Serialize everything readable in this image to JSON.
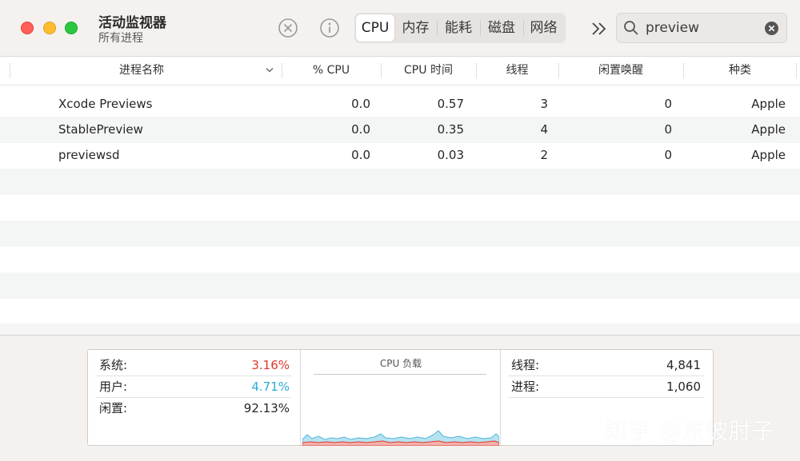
{
  "window": {
    "title": "活动监视器",
    "subtitle": "所有进程"
  },
  "toolbar": {
    "tabs": [
      {
        "label": "CPU",
        "active": true
      },
      {
        "label": "内存",
        "active": false
      },
      {
        "label": "能耗",
        "active": false
      },
      {
        "label": "磁盘",
        "active": false
      },
      {
        "label": "网络",
        "active": false
      }
    ],
    "search_value": "preview"
  },
  "table": {
    "headers": [
      "进程名称",
      "% CPU",
      "CPU 时间",
      "线程",
      "闲置唤醒",
      "种类"
    ],
    "rows": [
      {
        "name": "Xcode Previews",
        "cpu": "0.0",
        "time": "0.57",
        "threads": "3",
        "wakeups": "0",
        "kind": "Apple"
      },
      {
        "name": "StablePreview",
        "cpu": "0.0",
        "time": "0.35",
        "threads": "4",
        "wakeups": "0",
        "kind": "Apple"
      },
      {
        "name": "previewsd",
        "cpu": "0.0",
        "time": "0.03",
        "threads": "2",
        "wakeups": "0",
        "kind": "Apple"
      }
    ]
  },
  "summary": {
    "system_label": "系统:",
    "system_value": "3.16%",
    "user_label": "用户:",
    "user_value": "4.71%",
    "idle_label": "闲置:",
    "idle_value": "92.13%",
    "graph_title": "CPU 负载",
    "threads_label": "线程:",
    "threads_value": "4,841",
    "processes_label": "进程:",
    "processes_value": "1,060"
  },
  "colors": {
    "system": "#e0362c",
    "user": "#2aaed6"
  },
  "watermark": "知乎 @东坡肘子"
}
